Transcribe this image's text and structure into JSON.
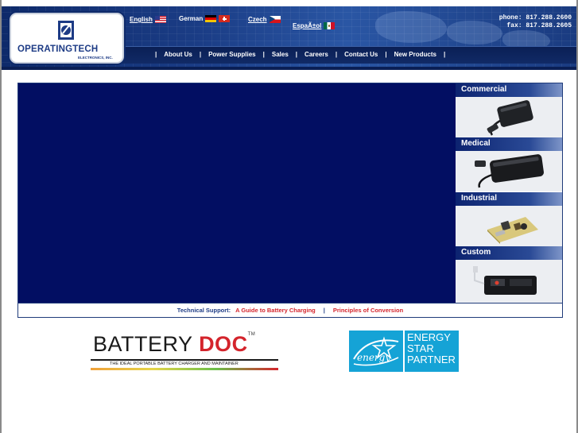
{
  "brand": {
    "logo_name": "OPERATINGTECH",
    "logo_sub": "ELECTRONICS, INC."
  },
  "languages": [
    {
      "label": "English",
      "flag": "us-flag-icon",
      "link": true
    },
    {
      "label": "German",
      "flag": "de-ch-flags-icon",
      "link": false
    },
    {
      "label": "Czech",
      "flag": "cz-flag-icon",
      "link": true
    },
    {
      "label": "EspaÃ±ol",
      "flag": "mx-flag-icon",
      "link": true
    }
  ],
  "contact": {
    "phone": "phone: 817.288.2600",
    "fax": "fax: 817.288.2605"
  },
  "nav": {
    "items": [
      "About Us",
      "Power Supplies",
      "Sales",
      "Careers",
      "Contact Us",
      "New Products"
    ],
    "separator": "|"
  },
  "categories": [
    {
      "label": "Commercial",
      "image": "laptop-adapter-image"
    },
    {
      "label": "Medical",
      "image": "medical-power-supply-image"
    },
    {
      "label": "Industrial",
      "image": "open-frame-board-image"
    },
    {
      "label": "Custom",
      "image": "custom-charger-image"
    }
  ],
  "tech_support": {
    "label": "Technical Support:",
    "links": [
      "A Guide to Battery Charging",
      "Principles of Conversion"
    ],
    "separator": "|"
  },
  "battery_doc": {
    "title_main": "BATTERY",
    "title_accent": "DOC",
    "tm": "TM",
    "tagline": "THE IDEAL PORTABLE BATTERY CHARGER AND MAINTAINER"
  },
  "energy_star": {
    "line1": "ENERGY",
    "line2": "STAR",
    "line3": "PARTNER",
    "script": "energy"
  },
  "colors": {
    "header_navy": "#0e2a6a",
    "hero_navy": "#020e62",
    "link_red": "#d4242c",
    "energy_blue": "#15a3d6"
  }
}
